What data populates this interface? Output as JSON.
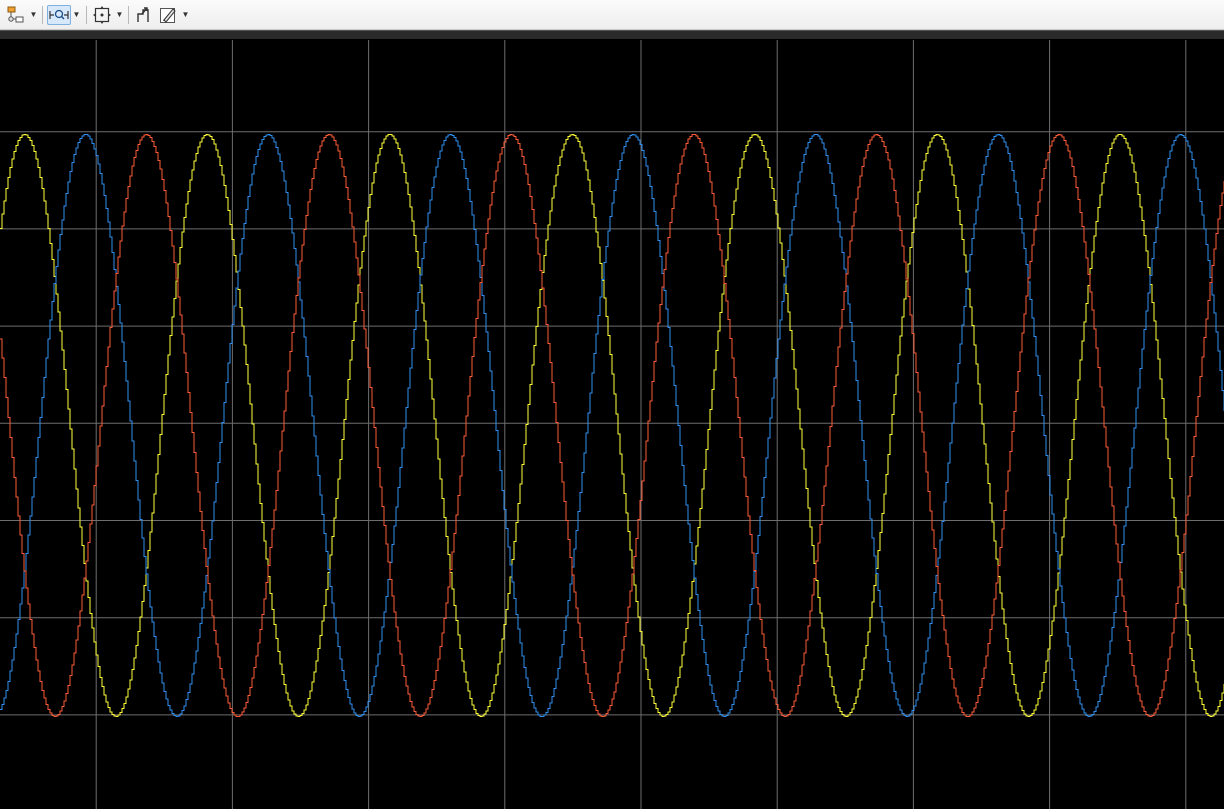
{
  "toolbar": {
    "buttons": [
      {
        "icon": "configuration-properties-icon",
        "has_dropdown": true,
        "active": false
      },
      {
        "icon": "zoom-in-icon",
        "has_dropdown": true,
        "active": true
      },
      {
        "icon": "autoscale-icon",
        "has_dropdown": true,
        "active": false
      },
      {
        "icon": "send-to-workspace-icon",
        "has_dropdown": false,
        "active": false
      },
      {
        "icon": "style-icon",
        "has_dropdown": true,
        "active": false
      }
    ]
  },
  "colors": {
    "background": "#000000",
    "grid": "#6e6e6e",
    "series": [
      "#ffff39",
      "#2f8ff0",
      "#ff5c39"
    ]
  },
  "chart_data": {
    "type": "line",
    "title": "",
    "xlabel": "",
    "ylabel": "",
    "grid": true,
    "legend": "none",
    "x_divisions": 9,
    "y_divisions": 8,
    "amplitude": 1,
    "period_divisions": 1.34,
    "style": "zero-order-hold staircase",
    "series": [
      {
        "color": "#ffff39",
        "phase_deg": 0
      },
      {
        "color": "#2f8ff0",
        "phase_deg": 120
      },
      {
        "color": "#ff5c39",
        "phase_deg": 240
      }
    ]
  }
}
